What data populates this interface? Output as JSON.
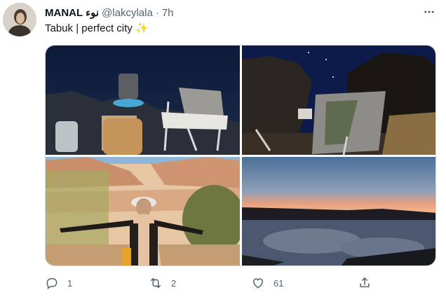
{
  "tweet": {
    "display_name": "MANAL نوء",
    "handle": "@lakcylala",
    "separator": "·",
    "time": "7h",
    "text": "Tabuk | perfect city",
    "emoji": "✨",
    "more_icon": "more-horizontal-icon"
  },
  "media": {
    "photos": [
      {
        "description_icon": "night-camping-photo"
      },
      {
        "description_icon": "night-rock-chair-photo"
      },
      {
        "description_icon": "desert-woman-photo"
      },
      {
        "description_icon": "sunset-lake-photo"
      }
    ]
  },
  "actions": {
    "reply_count": "1",
    "retweet_count": "2",
    "like_count": "61",
    "share_count": ""
  },
  "colors": {
    "text": "#0f1419",
    "secondary": "#536471",
    "border": "#cfd9de",
    "sparkle": "#f5b400"
  }
}
